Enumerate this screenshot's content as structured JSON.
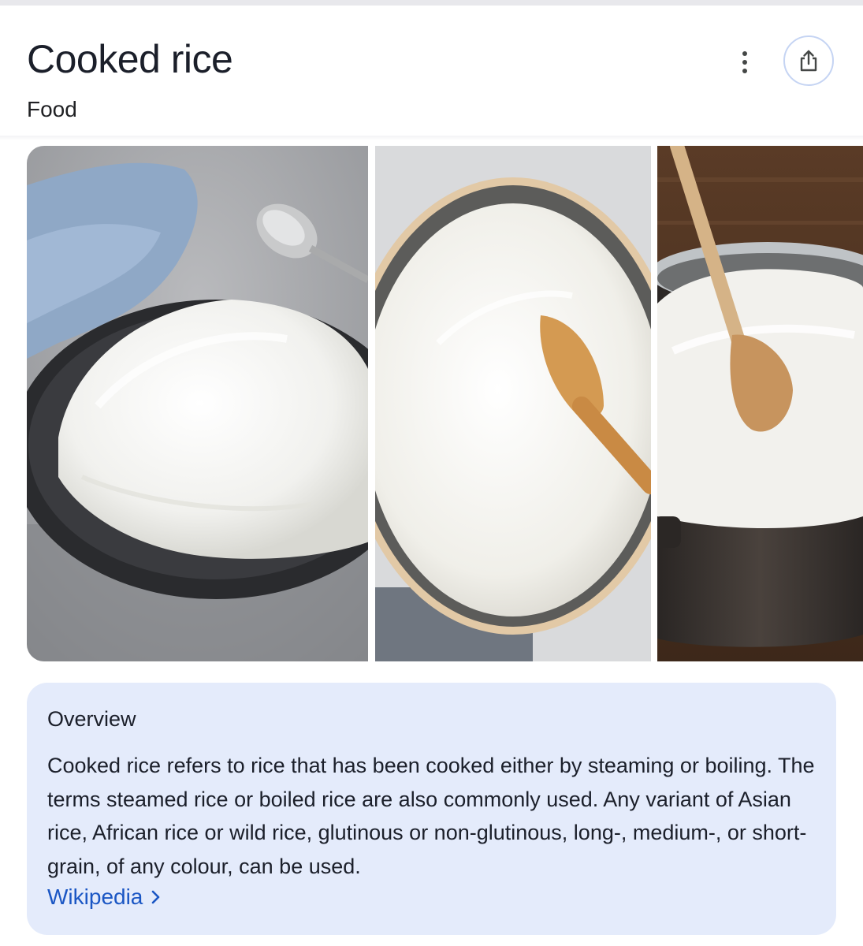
{
  "header": {
    "title": "Cooked rice",
    "subtitle": "Food",
    "more_icon": "more-vertical-icon",
    "share_icon": "share-icon"
  },
  "gallery": {
    "images": [
      {
        "description": "plate-of-rice-with-spoon-and-blue-napkin"
      },
      {
        "description": "bowl-of-rice-with-wooden-spoon"
      },
      {
        "description": "pot-of-rice-with-wooden-spoon"
      }
    ]
  },
  "overview": {
    "heading": "Overview",
    "text": "Cooked rice refers to rice that has been cooked either by steaming or boiling. The terms steamed rice or boiled rice are also commonly used. Any variant of Asian rice, African rice or wild rice, glutinous or non-glutinous, long-, medium-, or short-grain, of any colour, can be used.",
    "source_label": "Wikipedia",
    "source_icon": "chevron-right-icon"
  },
  "colors": {
    "card_background": "#e4ebfb",
    "link": "#1a56c4",
    "share_ring": "#c5d4f3"
  }
}
